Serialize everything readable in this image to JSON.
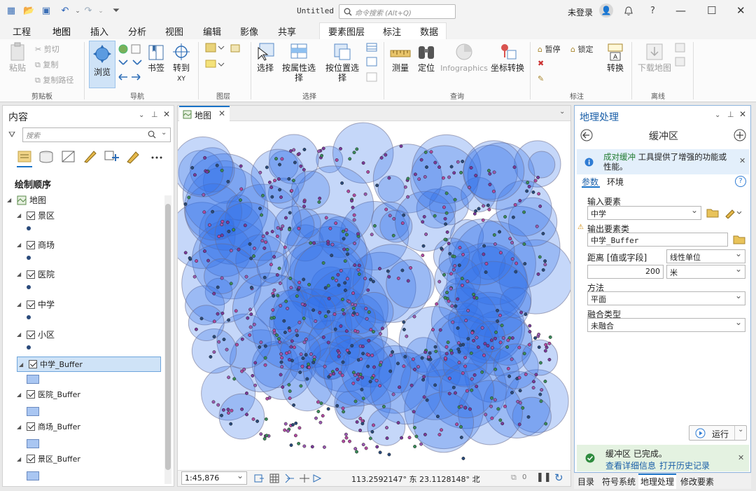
{
  "titlebar": {
    "title": "Untitled",
    "search_placeholder": "命令搜索 (Alt+Q)",
    "user": "未登录",
    "help": "?"
  },
  "tabs": [
    "工程",
    "地图",
    "插入",
    "分析",
    "视图",
    "编辑",
    "影像",
    "共享"
  ],
  "context_tabs": [
    "要素图层",
    "标注",
    "数据"
  ],
  "ribbon": {
    "clipboard": {
      "paste": "粘贴",
      "cut": "剪切",
      "copy": "复制",
      "copy_path": "复制路径",
      "group": "剪贴板"
    },
    "navigate": {
      "explore": "浏览",
      "bookmarks": "书签",
      "goto": "转到",
      "goto2": "XY",
      "group": "导航"
    },
    "layer": {
      "group": "图层"
    },
    "selection": {
      "select": "选择",
      "by_attr": "按属性选择",
      "by_loc": "按位置选择",
      "group": "选择"
    },
    "inquiry": {
      "measure": "测量",
      "locate": "定位",
      "infographics": "Infographics",
      "convert_coords": "坐标转换",
      "group": "查询"
    },
    "labeling": {
      "pause": "暂停",
      "lock": "锁定",
      "convert": "转换",
      "group": "标注"
    },
    "offline": {
      "download": "下载地图",
      "group": "离线"
    }
  },
  "contents": {
    "title": "内容",
    "search_placeholder": "搜索",
    "draw_order": "绘制顺序",
    "root": "地图",
    "layers": [
      {
        "name": "景区",
        "sym": "dot"
      },
      {
        "name": "商场",
        "sym": "dot"
      },
      {
        "name": "医院",
        "sym": "dot"
      },
      {
        "name": "中学",
        "sym": "dot"
      },
      {
        "name": "小区",
        "sym": "dot"
      },
      {
        "name": "中学_Buffer",
        "sym": "fill"
      },
      {
        "name": "医院_Buffer",
        "sym": "fill"
      },
      {
        "name": "商场_Buffer",
        "sym": "fill"
      },
      {
        "name": "景区_Buffer",
        "sym": "fill"
      }
    ]
  },
  "map": {
    "tab": "地图",
    "scale": "1:45,876",
    "coords": "113.2592147° 东 23.1128148° 北",
    "sel_count": "0"
  },
  "geoprocessing": {
    "title": "地理处理",
    "tool": "缓冲区",
    "info_link": "成对缓冲",
    "info_text": "工具提供了增强的功能或性能。",
    "tab_params": "参数",
    "tab_env": "环境",
    "input_label": "输入要素",
    "input_value": "中学",
    "output_label": "输出要素类",
    "output_value": "中学_Buffer",
    "distance_label": "距离 [值或字段]",
    "distance_unit_type": "线性单位",
    "distance_value": "200",
    "distance_unit": "米",
    "method_label": "方法",
    "method_value": "平面",
    "dissolve_label": "融合类型",
    "dissolve_value": "未融合",
    "run": "运行",
    "done_text": "缓冲区 已完成。",
    "details_link": "查看详细信息",
    "history_link": "打开历史记录"
  },
  "bottom_tabs": [
    "目录",
    "符号系统",
    "地理处理",
    "修改要素"
  ],
  "colors": {
    "accent": "#1a73c8",
    "buffer": "#2f6fe8",
    "point": "#7a3a9a"
  }
}
